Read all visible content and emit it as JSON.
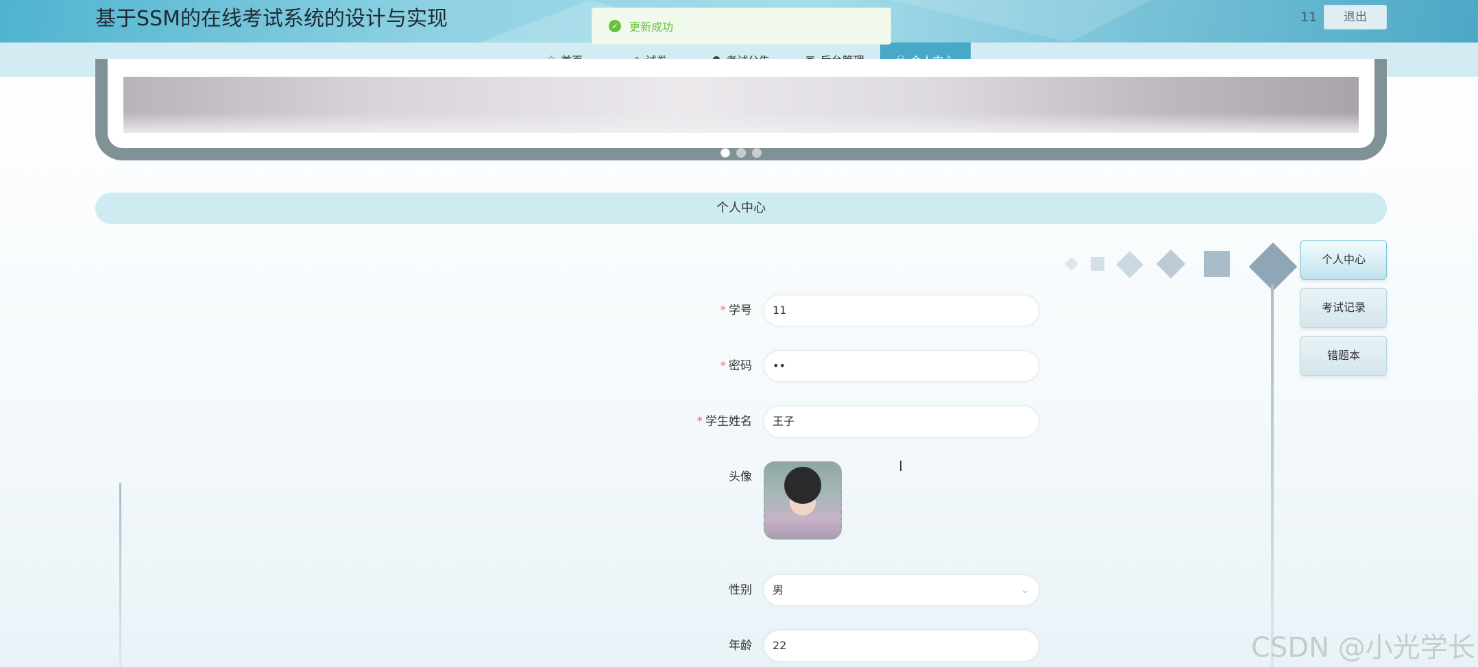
{
  "header": {
    "title": "基于SSM的在线考试系统的设计与实现",
    "username": "11",
    "logout_label": "退出"
  },
  "toast": {
    "message": "更新成功",
    "status_color": "#67c23a"
  },
  "nav": {
    "items": [
      {
        "label": "首页",
        "icon": "star-icon",
        "active": false
      },
      {
        "label": "试卷",
        "icon": "bag-icon",
        "active": false
      },
      {
        "label": "考试公告",
        "icon": "info-icon",
        "active": false
      },
      {
        "label": "后台管理",
        "icon": "briefcase-icon",
        "active": false
      },
      {
        "label": "个人中心",
        "icon": "user-icon",
        "active": true
      }
    ]
  },
  "carousel": {
    "slide_count": 3,
    "active_index": 0
  },
  "section": {
    "title": "个人中心"
  },
  "form": {
    "student_id": {
      "label": "学号",
      "required": true,
      "value": "11"
    },
    "password": {
      "label": "密码",
      "required": true,
      "value": "••"
    },
    "student_name": {
      "label": "学生姓名",
      "required": true,
      "value": "王子"
    },
    "avatar": {
      "label": "头像"
    },
    "gender": {
      "label": "性别",
      "value": "男"
    },
    "age": {
      "label": "年龄",
      "value": "22"
    }
  },
  "side_menu": {
    "items": [
      {
        "label": "个人中心",
        "active": true
      },
      {
        "label": "考试记录",
        "active": false
      },
      {
        "label": "错题本",
        "active": false
      }
    ]
  },
  "watermark": "CSDN @小光学长",
  "colors": {
    "accent": "#47a8c7",
    "required": "#f56c6c"
  }
}
